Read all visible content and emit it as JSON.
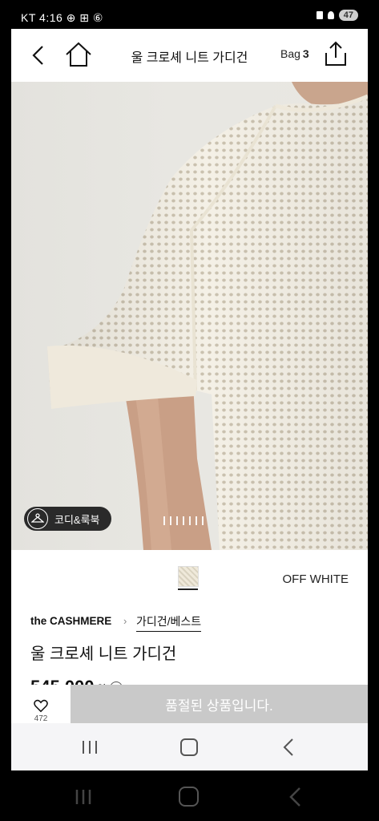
{
  "status_bar": {
    "left_text": "KT 4:16 ⊕ ⊞ ⑥",
    "battery": "47"
  },
  "header": {
    "title": "울 크로셰 니트 가디건",
    "bag_label": "Bag",
    "bag_count": "3"
  },
  "gallery": {
    "lookbook_label": "코디&룩북",
    "total_images": 7,
    "current_image": 1
  },
  "color": {
    "name": "OFF WHITE"
  },
  "product": {
    "brand": "the CASHMERE",
    "brand_chevron": "›",
    "category": "가디건/베스트",
    "name": "울 크로셰 니트 가디건",
    "price": "545,000",
    "currency": "원"
  },
  "bottom": {
    "wish_count": "472",
    "soldout_label": "품절된 상품입니다."
  },
  "colors": {
    "soldout_bg": "#c9c9c9",
    "chip_bg": "#2a2a2a",
    "knit": "#f3efe4"
  }
}
